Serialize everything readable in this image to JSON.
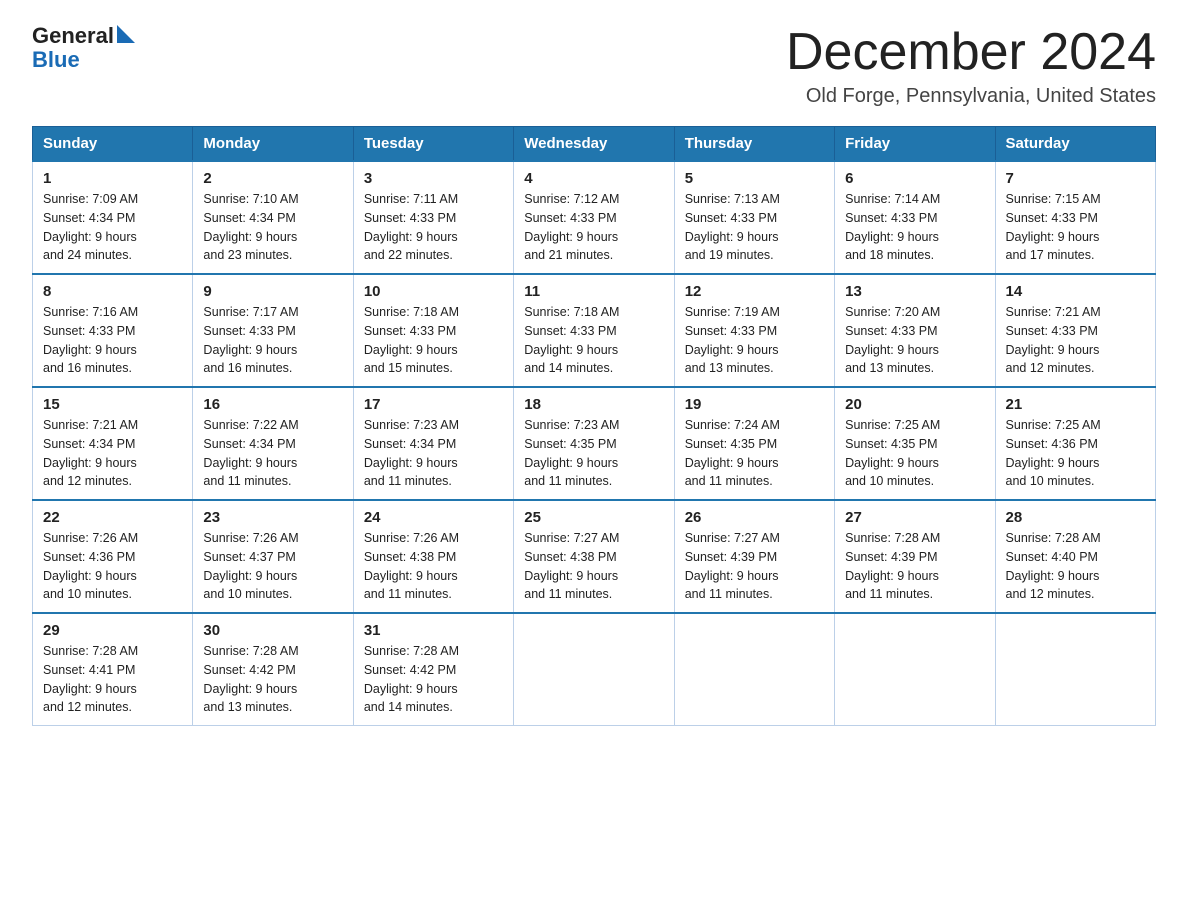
{
  "logo": {
    "general": "General",
    "blue": "Blue"
  },
  "title": "December 2024",
  "subtitle": "Old Forge, Pennsylvania, United States",
  "days_of_week": [
    "Sunday",
    "Monday",
    "Tuesday",
    "Wednesday",
    "Thursday",
    "Friday",
    "Saturday"
  ],
  "weeks": [
    [
      {
        "day": "1",
        "sunrise": "7:09 AM",
        "sunset": "4:34 PM",
        "daylight": "9 hours and 24 minutes."
      },
      {
        "day": "2",
        "sunrise": "7:10 AM",
        "sunset": "4:34 PM",
        "daylight": "9 hours and 23 minutes."
      },
      {
        "day": "3",
        "sunrise": "7:11 AM",
        "sunset": "4:33 PM",
        "daylight": "9 hours and 22 minutes."
      },
      {
        "day": "4",
        "sunrise": "7:12 AM",
        "sunset": "4:33 PM",
        "daylight": "9 hours and 21 minutes."
      },
      {
        "day": "5",
        "sunrise": "7:13 AM",
        "sunset": "4:33 PM",
        "daylight": "9 hours and 19 minutes."
      },
      {
        "day": "6",
        "sunrise": "7:14 AM",
        "sunset": "4:33 PM",
        "daylight": "9 hours and 18 minutes."
      },
      {
        "day": "7",
        "sunrise": "7:15 AM",
        "sunset": "4:33 PM",
        "daylight": "9 hours and 17 minutes."
      }
    ],
    [
      {
        "day": "8",
        "sunrise": "7:16 AM",
        "sunset": "4:33 PM",
        "daylight": "9 hours and 16 minutes."
      },
      {
        "day": "9",
        "sunrise": "7:17 AM",
        "sunset": "4:33 PM",
        "daylight": "9 hours and 16 minutes."
      },
      {
        "day": "10",
        "sunrise": "7:18 AM",
        "sunset": "4:33 PM",
        "daylight": "9 hours and 15 minutes."
      },
      {
        "day": "11",
        "sunrise": "7:18 AM",
        "sunset": "4:33 PM",
        "daylight": "9 hours and 14 minutes."
      },
      {
        "day": "12",
        "sunrise": "7:19 AM",
        "sunset": "4:33 PM",
        "daylight": "9 hours and 13 minutes."
      },
      {
        "day": "13",
        "sunrise": "7:20 AM",
        "sunset": "4:33 PM",
        "daylight": "9 hours and 13 minutes."
      },
      {
        "day": "14",
        "sunrise": "7:21 AM",
        "sunset": "4:33 PM",
        "daylight": "9 hours and 12 minutes."
      }
    ],
    [
      {
        "day": "15",
        "sunrise": "7:21 AM",
        "sunset": "4:34 PM",
        "daylight": "9 hours and 12 minutes."
      },
      {
        "day": "16",
        "sunrise": "7:22 AM",
        "sunset": "4:34 PM",
        "daylight": "9 hours and 11 minutes."
      },
      {
        "day": "17",
        "sunrise": "7:23 AM",
        "sunset": "4:34 PM",
        "daylight": "9 hours and 11 minutes."
      },
      {
        "day": "18",
        "sunrise": "7:23 AM",
        "sunset": "4:35 PM",
        "daylight": "9 hours and 11 minutes."
      },
      {
        "day": "19",
        "sunrise": "7:24 AM",
        "sunset": "4:35 PM",
        "daylight": "9 hours and 11 minutes."
      },
      {
        "day": "20",
        "sunrise": "7:25 AM",
        "sunset": "4:35 PM",
        "daylight": "9 hours and 10 minutes."
      },
      {
        "day": "21",
        "sunrise": "7:25 AM",
        "sunset": "4:36 PM",
        "daylight": "9 hours and 10 minutes."
      }
    ],
    [
      {
        "day": "22",
        "sunrise": "7:26 AM",
        "sunset": "4:36 PM",
        "daylight": "9 hours and 10 minutes."
      },
      {
        "day": "23",
        "sunrise": "7:26 AM",
        "sunset": "4:37 PM",
        "daylight": "9 hours and 10 minutes."
      },
      {
        "day": "24",
        "sunrise": "7:26 AM",
        "sunset": "4:38 PM",
        "daylight": "9 hours and 11 minutes."
      },
      {
        "day": "25",
        "sunrise": "7:27 AM",
        "sunset": "4:38 PM",
        "daylight": "9 hours and 11 minutes."
      },
      {
        "day": "26",
        "sunrise": "7:27 AM",
        "sunset": "4:39 PM",
        "daylight": "9 hours and 11 minutes."
      },
      {
        "day": "27",
        "sunrise": "7:28 AM",
        "sunset": "4:39 PM",
        "daylight": "9 hours and 11 minutes."
      },
      {
        "day": "28",
        "sunrise": "7:28 AM",
        "sunset": "4:40 PM",
        "daylight": "9 hours and 12 minutes."
      }
    ],
    [
      {
        "day": "29",
        "sunrise": "7:28 AM",
        "sunset": "4:41 PM",
        "daylight": "9 hours and 12 minutes."
      },
      {
        "day": "30",
        "sunrise": "7:28 AM",
        "sunset": "4:42 PM",
        "daylight": "9 hours and 13 minutes."
      },
      {
        "day": "31",
        "sunrise": "7:28 AM",
        "sunset": "4:42 PM",
        "daylight": "9 hours and 14 minutes."
      },
      null,
      null,
      null,
      null
    ]
  ],
  "labels": {
    "sunrise": "Sunrise:",
    "sunset": "Sunset:",
    "daylight": "Daylight:"
  }
}
